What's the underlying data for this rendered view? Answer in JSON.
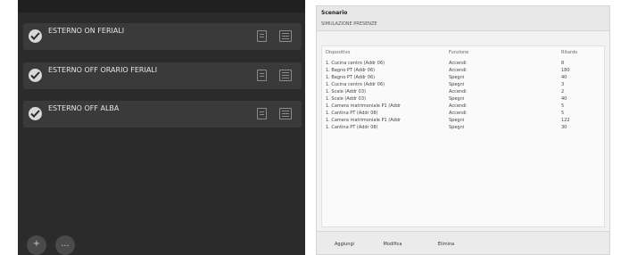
{
  "left": {
    "header_title": "",
    "scenes": [
      {
        "name": "ESTERNO ON FERIALI",
        "desc": ""
      },
      {
        "name": "ESTERNO OFF ORARIO FERIALI",
        "desc": ""
      },
      {
        "name": "ESTERNO OFF ALBA",
        "desc": ""
      }
    ],
    "round_buttons": [
      "+",
      "..."
    ]
  },
  "right": {
    "scenario_label": "Scenario",
    "scenario_value": "SIMULAZIONE PRESENZE",
    "columns": [
      "Dispositivo",
      "Funzione",
      "Ritardo"
    ],
    "rows": [
      {
        "device": "1. Cucina centro (Addr 06)",
        "function": "Accendi",
        "delay": "8"
      },
      {
        "device": "1. Bagno PT (Addr 06)",
        "function": "Accendi",
        "delay": "180"
      },
      {
        "device": "1. Bagno PT (Addr 06)",
        "function": "Spegni",
        "delay": "40"
      },
      {
        "device": "1. Cucina centro (Addr 06)",
        "function": "Spegni",
        "delay": "3"
      },
      {
        "device": "1. Scale (Addr 03)",
        "function": "Accendi",
        "delay": "2"
      },
      {
        "device": "1. Scale (Addr 03)",
        "function": "Spegni",
        "delay": "40"
      },
      {
        "device": "1. Camera matrimoniale P1 (Addr",
        "function": "Accendi",
        "delay": "5"
      },
      {
        "device": "1. Cantina PT (Addr 08)",
        "function": "Accendi",
        "delay": "5"
      },
      {
        "device": "1. Camera matrimoniale P1 (Addr",
        "function": "Spegni",
        "delay": "122"
      },
      {
        "device": "1. Cantina PT (Addr 08)",
        "function": "Spegni",
        "delay": "30"
      }
    ],
    "footer": {
      "add": "Aggiungi",
      "edit": "Modifica",
      "remove": "Elimina",
      "run": ""
    }
  }
}
